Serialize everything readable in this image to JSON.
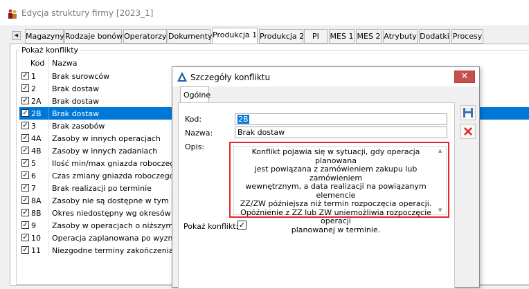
{
  "window": {
    "title": "Edycja struktury firmy [2023_1]"
  },
  "tabs": [
    {
      "label": "Magazyny"
    },
    {
      "label": "Rodzaje bonów"
    },
    {
      "label": "Operatorzy"
    },
    {
      "label": "Dokumenty"
    },
    {
      "label": "Produkcja 1",
      "active": true
    },
    {
      "label": "Produkcja 2"
    },
    {
      "label": "PI"
    },
    {
      "label": "MES 1"
    },
    {
      "label": "MES 2"
    },
    {
      "label": "Atrybuty"
    },
    {
      "label": "Dodatki"
    },
    {
      "label": "Procesy"
    }
  ],
  "group": {
    "label": "Pokaż konflikty"
  },
  "grid": {
    "columns": [
      "Kod",
      "Nazwa"
    ],
    "rows": [
      {
        "checked": true,
        "kod": "1",
        "nazwa": "Brak surowców"
      },
      {
        "checked": true,
        "kod": "2",
        "nazwa": "Brak dostaw"
      },
      {
        "checked": true,
        "kod": "2A",
        "nazwa": "Brak dostaw"
      },
      {
        "checked": true,
        "kod": "2B",
        "nazwa": "Brak dostaw",
        "selected": true
      },
      {
        "checked": true,
        "kod": "3",
        "nazwa": "Brak zasobów"
      },
      {
        "checked": true,
        "kod": "4A",
        "nazwa": "Zasoby w innych operacjach"
      },
      {
        "checked": true,
        "kod": "4B",
        "nazwa": "Zasoby w innych zadaniach"
      },
      {
        "checked": true,
        "kod": "5",
        "nazwa": "Ilość min/max gniazda roboczego"
      },
      {
        "checked": true,
        "kod": "6",
        "nazwa": "Czas zmiany gniazda roboczego"
      },
      {
        "checked": true,
        "kod": "7",
        "nazwa": "Brak realizacji po terminie"
      },
      {
        "checked": true,
        "kod": "8A",
        "nazwa": "Zasoby nie są dostępne w tym okres"
      },
      {
        "checked": true,
        "kod": "8B",
        "nazwa": "Okres niedostępny wg okresów wsp"
      },
      {
        "checked": true,
        "kod": "9",
        "nazwa": "Zasoby w operacjach o niższym prio"
      },
      {
        "checked": true,
        "kod": "10",
        "nazwa": "Operacja zaplanowana po wyznacz"
      },
      {
        "checked": true,
        "kod": "11",
        "nazwa": "Niezgodne terminy zakończenia/rozp"
      }
    ]
  },
  "dialog": {
    "title": "Szczegóły konfliktu",
    "tab": "Ogólne",
    "kod_label": "Kod:",
    "kod_value": "2B",
    "nazwa_label": "Nazwa:",
    "nazwa_value": "Brak dostaw",
    "opis_label": "Opis:",
    "opis_lines": [
      "Konflikt pojawia się w sytuacji, gdy operacja planowana",
      "jest powiązana z zamówieniem zakupu lub zamówieniem",
      "wewnętrznym, a  data realizacji na powiązanym elemencie",
      "ZZ/ZW późniejsza niż termin rozpoczęcia operacji.",
      "Opóźnienie z ZZ lub ZW uniemożliwia rozpoczęcie operacji",
      "planowanej w terminie."
    ],
    "pokaz_label": "Pokaż konflikt:",
    "pokaz_checked": true
  },
  "colors": {
    "selection": "#0078d7",
    "highlight_border": "#e8222b",
    "close_button": "#c75050"
  },
  "icons": {
    "window": "users-icon",
    "dialog": "conflict-triangle-icon",
    "save": "floppy-disk-icon",
    "delete": "red-x-icon",
    "close": "close-icon"
  }
}
